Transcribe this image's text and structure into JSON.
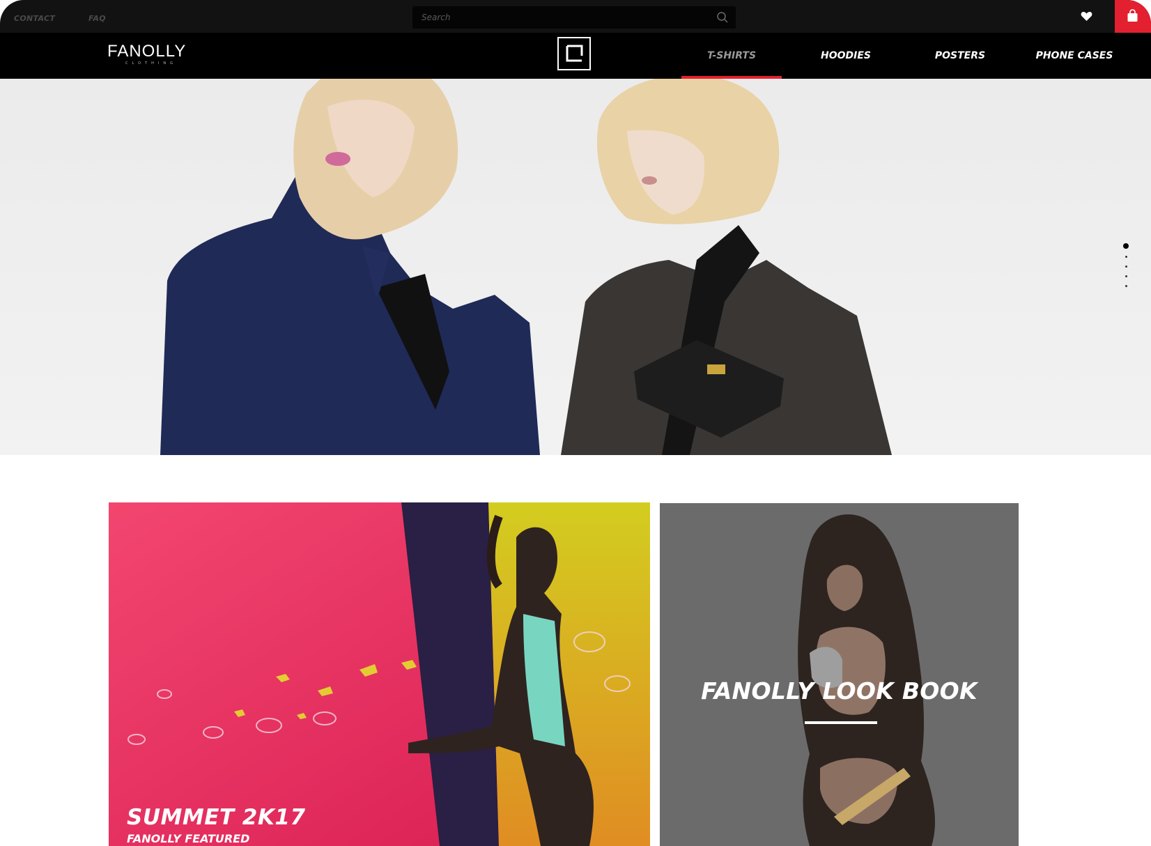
{
  "utility_bar": {
    "contact_label": "CONTACT",
    "faq_label": "FAQ",
    "search_placeholder": "Search"
  },
  "brand": {
    "name": "FANOLLY",
    "tagline": "CLOTHING"
  },
  "nav": {
    "items": [
      {
        "label": "T-SHIRTS",
        "active": true
      },
      {
        "label": "HOODIES",
        "active": false
      },
      {
        "label": "POSTERS",
        "active": false
      },
      {
        "label": "PHONE CASES",
        "active": false
      }
    ]
  },
  "hero": {
    "slide_count": 5,
    "active_slide": 1
  },
  "cards": {
    "summer": {
      "title": "SUMMET 2K17",
      "subtitle": "FANOLLY FEATURED"
    },
    "lookbook": {
      "title": "FANOLLY LOOK BOOK"
    }
  },
  "colors": {
    "accent": "#e3202f",
    "topbar": "#121212",
    "nav": "#000000",
    "lookbook_overlay": "#6b6b6b"
  },
  "icons": {
    "search": "search-icon",
    "wishlist": "heart-icon",
    "cart": "bag-icon",
    "center_logo": "square-l-logo-icon"
  }
}
